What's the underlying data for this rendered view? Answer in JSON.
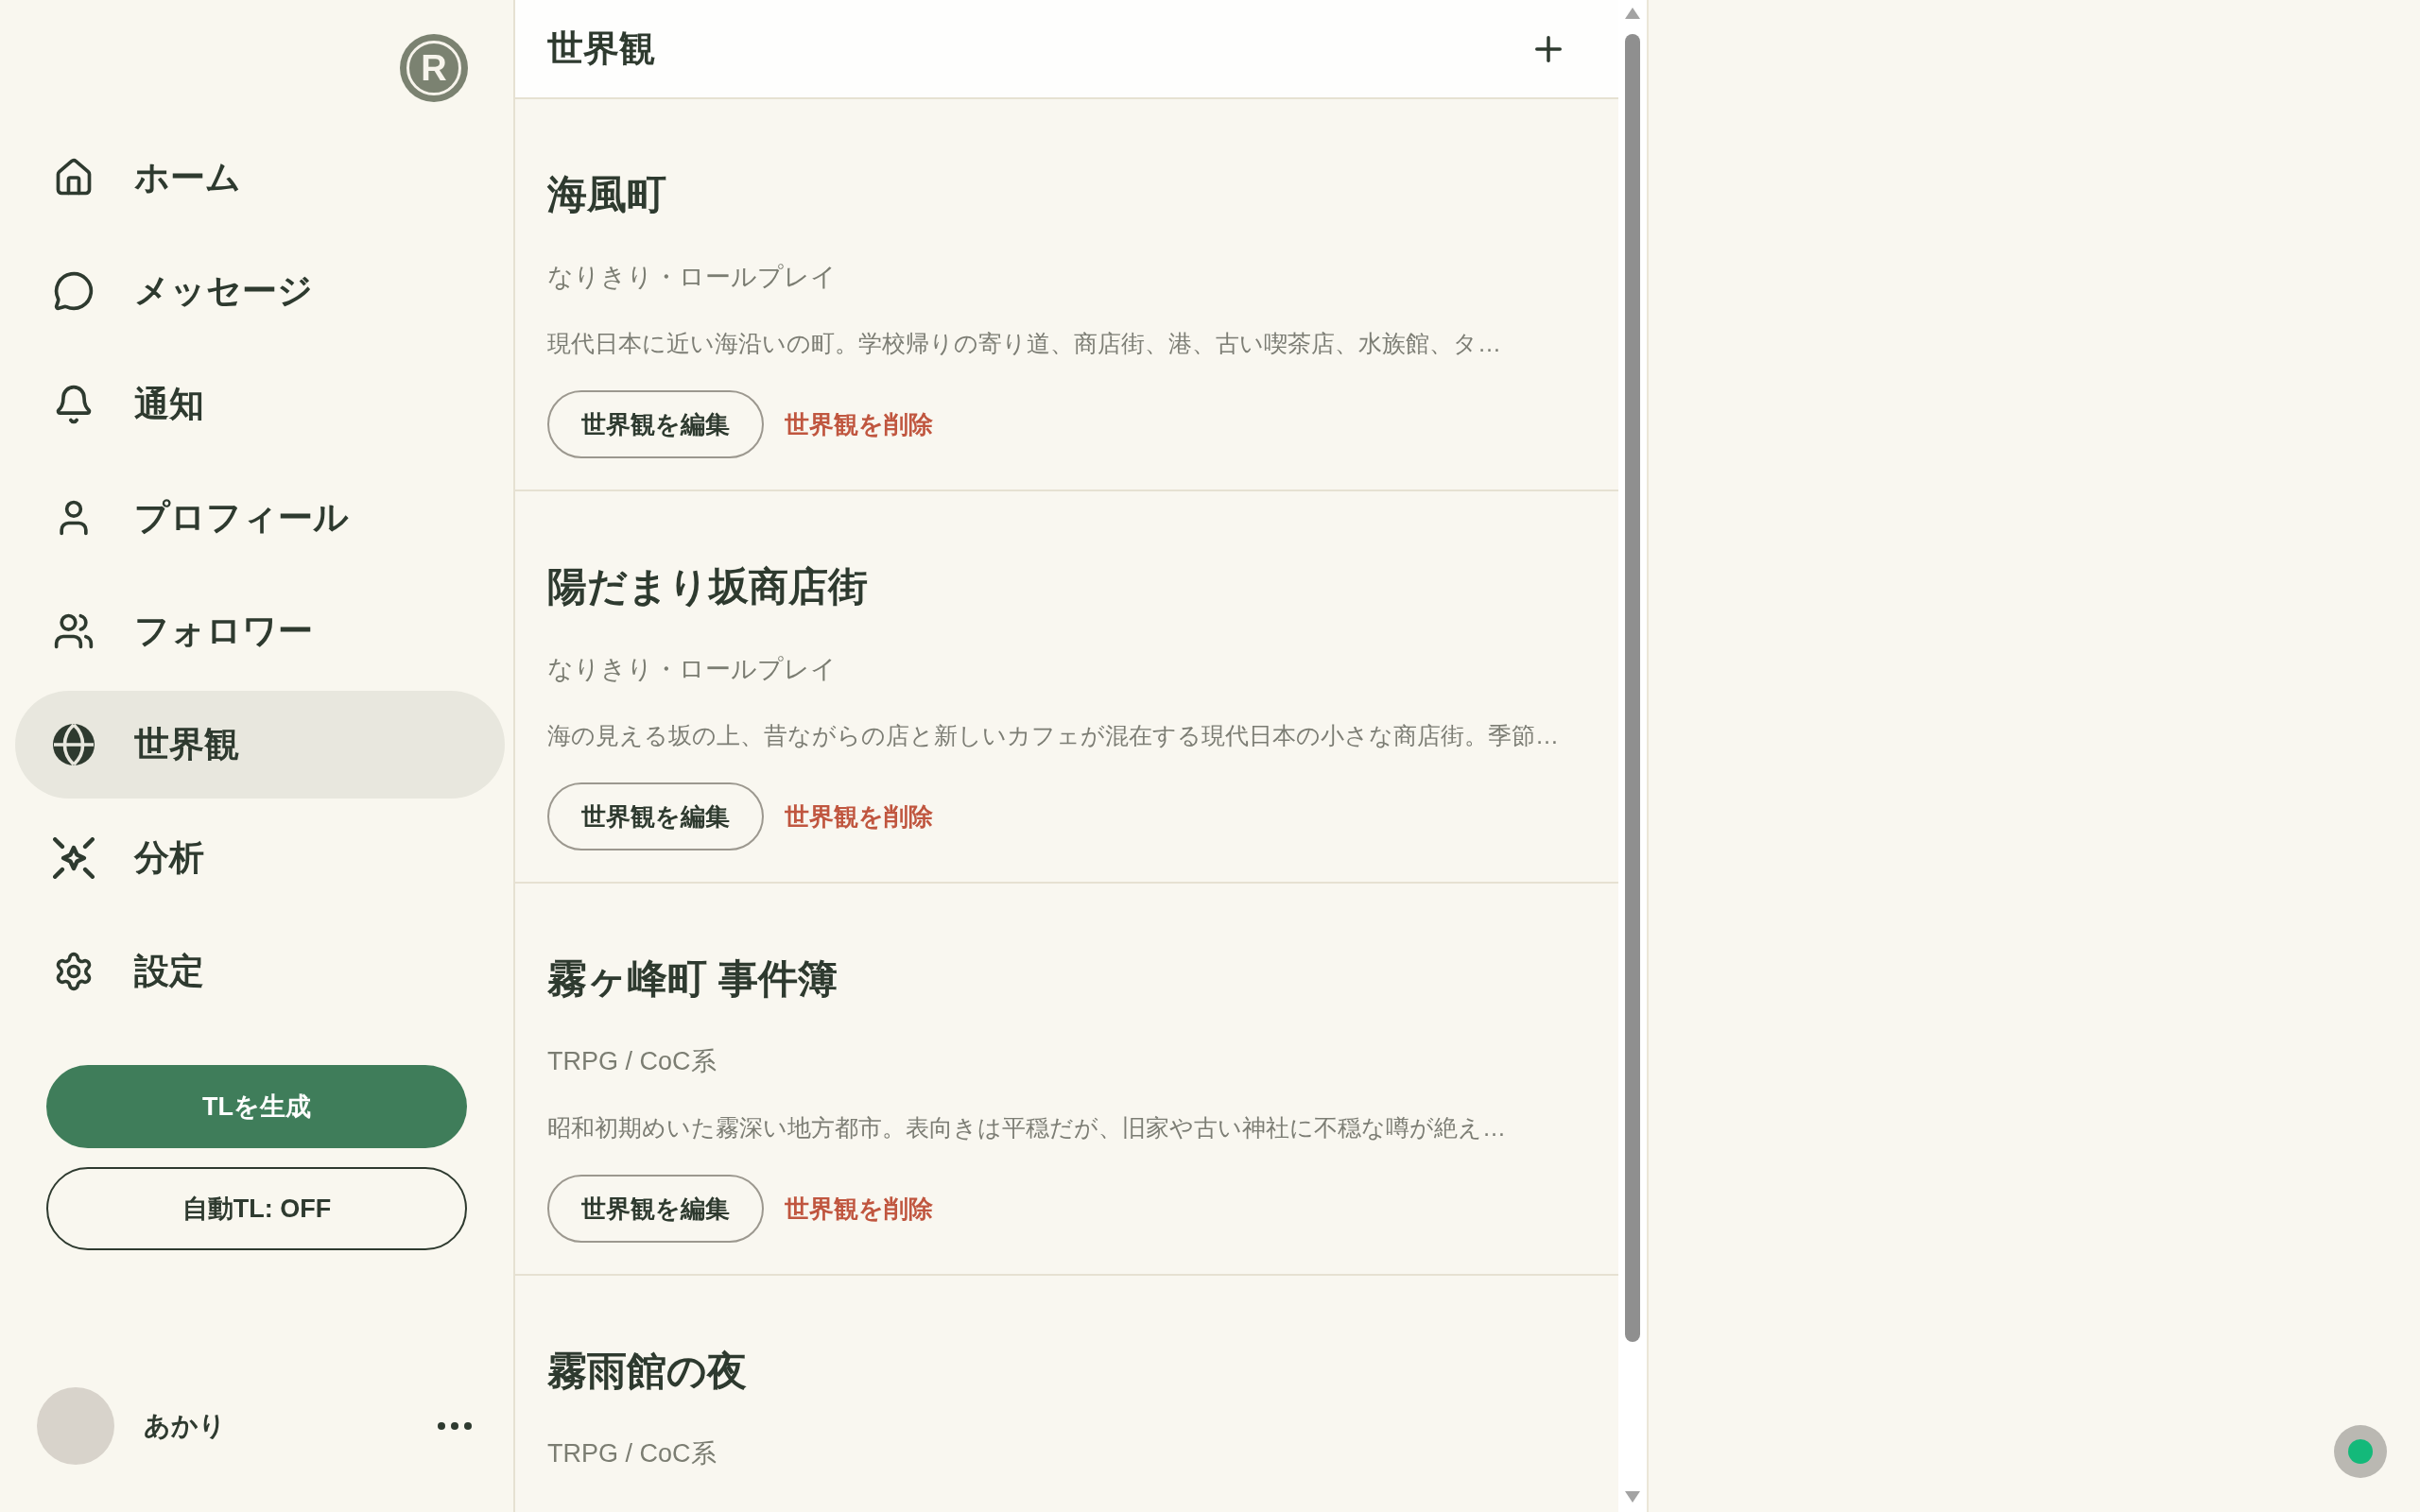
{
  "sidebar": {
    "logo": "R",
    "nav": [
      {
        "label": "ホーム",
        "selected": false
      },
      {
        "label": "メッセージ",
        "selected": false
      },
      {
        "label": "通知",
        "selected": false
      },
      {
        "label": "プロフィール",
        "selected": false
      },
      {
        "label": "フォロワー",
        "selected": false
      },
      {
        "label": "世界観",
        "selected": true
      },
      {
        "label": "分析",
        "selected": false
      },
      {
        "label": "設定",
        "selected": false
      }
    ],
    "buttons": [
      {
        "label": "TLを生成",
        "kind": "primary"
      },
      {
        "label": "自動TL: OFF",
        "kind": "outline"
      }
    ],
    "user": {
      "name": "あかり"
    }
  },
  "main": {
    "title": "世界観",
    "worlds": [
      {
        "title": "海風町",
        "genre": "なりきり・ロールプレイ",
        "description": "現代日本に近い海沿いの町。学校帰りの寄り道、商店街、港、古い喫茶店、水族館、タ…",
        "actions": [
          {
            "label": "世界観を編集",
            "kind": "edit"
          },
          {
            "label": "世界観を削除",
            "kind": "delete"
          }
        ]
      },
      {
        "title": "陽だまり坂商店街",
        "genre": "なりきり・ロールプレイ",
        "description": "海の見える坂の上、昔ながらの店と新しいカフェが混在する現代日本の小さな商店街。季節…",
        "actions": [
          {
            "label": "世界観を編集",
            "kind": "edit"
          },
          {
            "label": "世界観を削除",
            "kind": "delete"
          }
        ]
      },
      {
        "title": "霧ヶ峰町 事件簿",
        "genre": "TRPG / CoC系",
        "description": "昭和初期めいた霧深い地方都市。表向きは平穏だが、旧家や古い神社に不穏な噂が絶え…",
        "actions": [
          {
            "label": "世界観を編集",
            "kind": "edit"
          },
          {
            "label": "世界観を削除",
            "kind": "delete"
          }
        ]
      },
      {
        "title": "霧雨館の夜",
        "genre": "TRPG / CoC系"
      }
    ]
  }
}
